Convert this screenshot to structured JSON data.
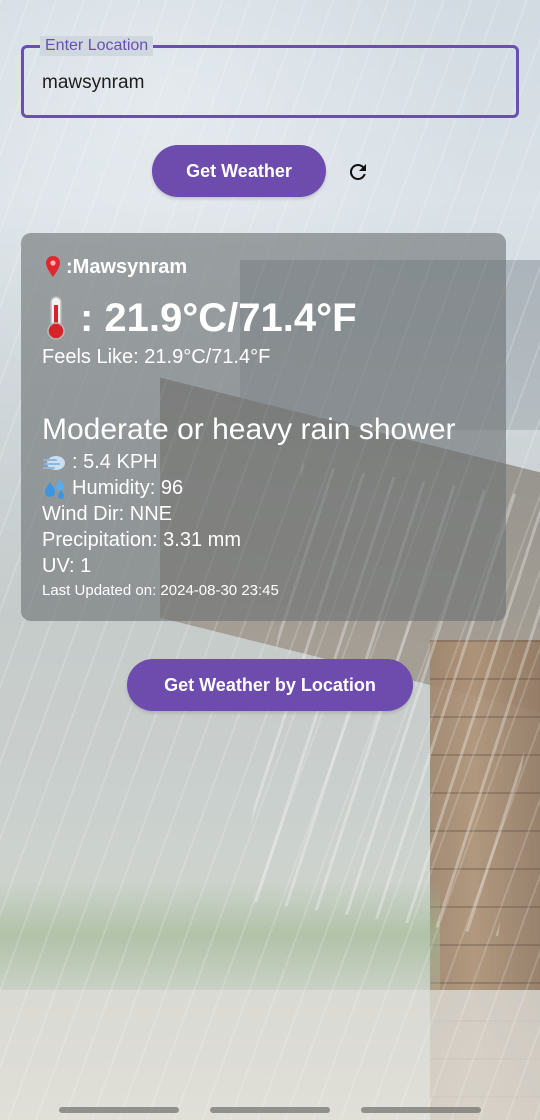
{
  "input": {
    "label": "Enter Location",
    "value": "mawsynram"
  },
  "buttons": {
    "get_weather": "Get Weather",
    "get_weather_by_location": "Get Weather by Location"
  },
  "weather": {
    "location_prefix": ": ",
    "location": "Mawsynram",
    "temperature": ": 21.9°C/71.4°F",
    "feels_like": "Feels Like: 21.9°C/71.4°F",
    "condition": "Moderate or heavy rain shower",
    "wind": ": 5.4 KPH",
    "humidity": "Humidity: 96",
    "wind_dir": "Wind Dir: NNE",
    "precipitation": "Precipitation: 3.31 mm",
    "uv": "UV: 1",
    "last_updated": "Last Updated on: 2024-08-30 23:45"
  },
  "icons": {
    "location": "pin-icon",
    "temperature": "thermometer-icon",
    "wind": "wind-icon",
    "humidity": "droplets-icon",
    "refresh": "refresh-icon"
  },
  "colors": {
    "accent": "#6d4cae",
    "field_border": "#6a4fb0",
    "card": "rgba(110,114,116,0.62)"
  }
}
